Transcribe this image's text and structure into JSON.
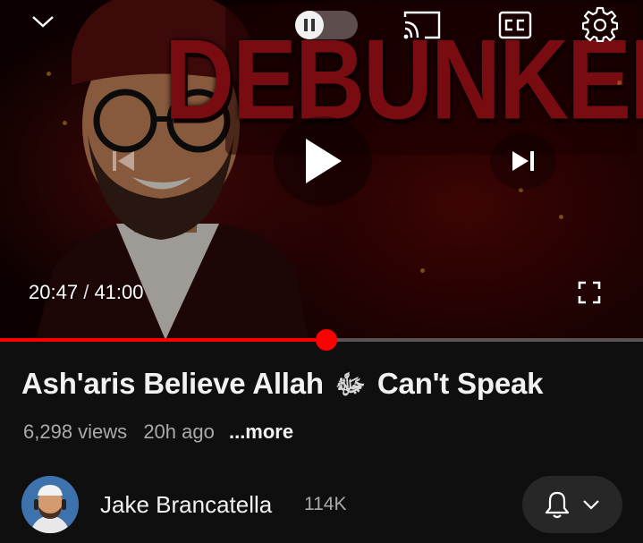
{
  "player": {
    "thumbnail_text": "DEBUNKED",
    "current_time": "20:47",
    "separator": "/",
    "duration": "41:00",
    "progress_fraction": 0.508,
    "state": "paused",
    "colors": {
      "progress": "#ff0000",
      "thumbnail_text": "#b3121a"
    },
    "icons": [
      "chevron-down-icon",
      "pause-icon",
      "cast-icon",
      "closed-captions-icon",
      "settings-gear-icon",
      "previous-icon",
      "play-icon",
      "next-icon",
      "fullscreen-icon"
    ]
  },
  "video": {
    "title_before": "Ash'aris Believe Allah",
    "title_glyph": "ﷻ",
    "title_after": "Can't Speak",
    "views": "6,298 views",
    "uploaded": "20h ago",
    "more_label": "...more"
  },
  "channel": {
    "name": "Jake Brancatella",
    "subscribers": "114K",
    "subscription_icons": [
      "bell-icon",
      "chevron-down-icon"
    ]
  }
}
